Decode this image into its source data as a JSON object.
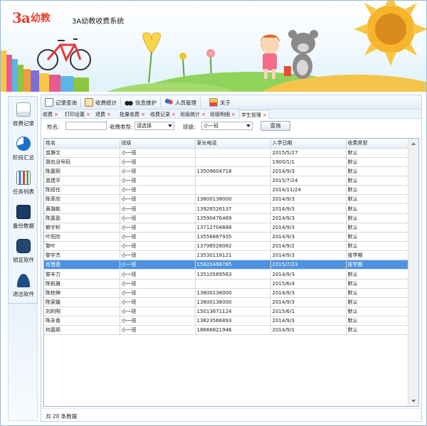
{
  "app": {
    "logo_3a": "3a",
    "logo_cn": "幼教",
    "title": "3A幼教收费系统"
  },
  "colors": {
    "brand": "#e8412c",
    "selected_row": "#4f93e0",
    "panel_border": "#b9d0ea"
  },
  "sidebar": {
    "items": [
      {
        "label": "收费记录",
        "icon": "document-pen-icon"
      },
      {
        "label": "阶段汇总",
        "icon": "pie-chart-icon"
      },
      {
        "label": "任务列表",
        "icon": "bar-chart-icon"
      },
      {
        "label": "备份数据",
        "icon": "backup-icon"
      },
      {
        "label": "锁定软件",
        "icon": "lock-icon"
      },
      {
        "label": "退出软件",
        "icon": "user-exit-icon"
      }
    ]
  },
  "toolbar": {
    "items": [
      {
        "label": "记录查询",
        "icon": "search-doc-icon"
      },
      {
        "label": "收费统计",
        "icon": "edit-icon"
      },
      {
        "label": "信息维护",
        "icon": "binoculars-icon"
      },
      {
        "label": "人员管理",
        "icon": "people-icon"
      },
      {
        "label": "关于",
        "icon": "info-icon"
      }
    ]
  },
  "tabs": [
    "收费",
    "打印设置",
    "退费",
    "批量收费",
    "收费记录",
    "班级统计",
    "班级明细",
    "学生管理"
  ],
  "search": {
    "name_label": "姓名:",
    "name_value": "",
    "type_label": "收费类型:",
    "type_value": "请选择",
    "class_label": "班级:",
    "class_value": "小一班",
    "query_label": "查询"
  },
  "table": {
    "columns": [
      "姓名",
      "班级",
      "家长电话",
      "入学日期",
      "收费类型"
    ],
    "rows": [
      [
        "曾静文",
        "小一班",
        "",
        "2015/5/27",
        "默认"
      ],
      [
        "我也没号码",
        "小一班",
        "",
        "1900/1/1",
        "默认"
      ],
      [
        "陈嘉熙",
        "小一班",
        "13509604718",
        "2014/9/3",
        "默认"
      ],
      [
        "曾建平",
        "小一班",
        "",
        "2015/7/24",
        "默认"
      ],
      [
        "陈綧任",
        "小一班",
        "",
        "2014/11/24",
        "默认"
      ],
      [
        "陈萃欣",
        "小一班",
        "13800138000",
        "2014/9/3",
        "默认"
      ],
      [
        "黄璐乾",
        "小一班",
        "13926526137",
        "2014/9/3",
        "默认"
      ],
      [
        "陈嘉盈",
        "小一班",
        "13590476469",
        "2014/9/3",
        "默认"
      ],
      [
        "赖宇轩",
        "小一班",
        "13712704888",
        "2014/9/3",
        "默认"
      ],
      [
        "叶阳欣",
        "小一班",
        "13556867935",
        "2014/9/3",
        "默认"
      ],
      [
        "黎叶",
        "小一班",
        "13798528082",
        "2014/9/2",
        "默认"
      ],
      [
        "黎宇杰",
        "小一班",
        "13530118121",
        "2014/9/3",
        "按学期"
      ],
      [
        "肖慧茵",
        "小一班",
        "15820498785",
        "2015/7/23",
        "按学期"
      ],
      [
        "黎丰力",
        "小一班",
        "13510569563",
        "2014/9/3",
        "默认"
      ],
      [
        "陈帆雅",
        "小一班",
        "",
        "2015/6/4",
        "默认"
      ],
      [
        "陈柏伸",
        "小一班",
        "13800138000",
        "2014/9/3",
        "默认"
      ],
      [
        "陈家媛",
        "小一班",
        "13800138000",
        "2014/9/3",
        "默认"
      ],
      [
        "刘利明",
        "小一班",
        "15013671124",
        "2015/6/1",
        "默认"
      ],
      [
        "陈永香",
        "小一班",
        "13823566893",
        "2014/9/3",
        "默认"
      ],
      [
        "何嘉熙",
        "小一班",
        "18666821946",
        "2014/9/1",
        "默认"
      ]
    ],
    "selected_row": 12
  },
  "footer": {
    "count_text": "共 20 条数据"
  }
}
